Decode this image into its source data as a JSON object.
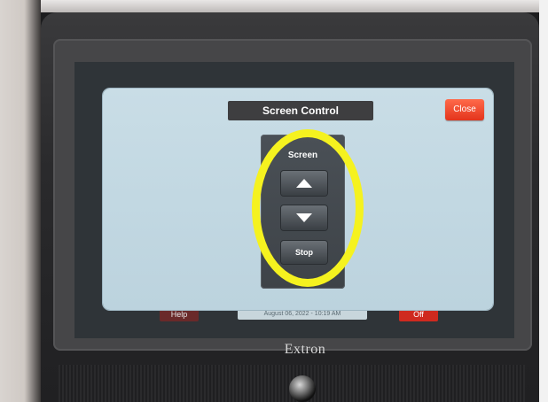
{
  "dialog": {
    "title": "Screen Control",
    "close_label": "Close",
    "panel_label": "Screen",
    "up_icon": "triangle-up-icon",
    "down_icon": "triangle-down-icon",
    "stop_label": "Stop"
  },
  "underlying": {
    "help_label": "Help",
    "date_text": "August 06, 2022 - 10:19 AM",
    "off_label": "Off"
  },
  "device": {
    "brand": "Extron"
  },
  "colors": {
    "highlight": "#f5f21f",
    "close": "#e3341c",
    "dialog_bg": "#c9dde6"
  }
}
